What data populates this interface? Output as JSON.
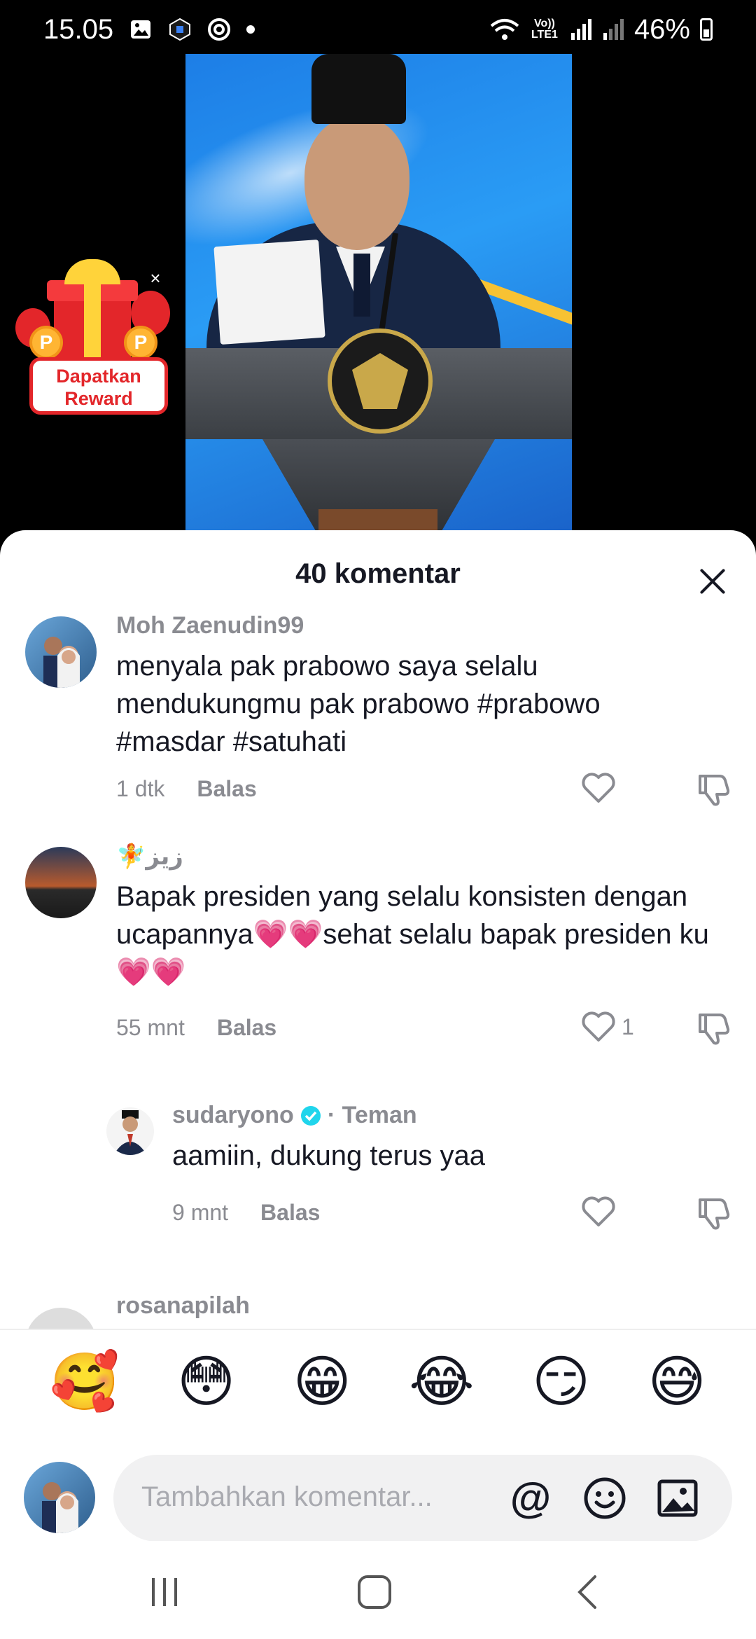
{
  "status_bar": {
    "time": "15.05",
    "battery": "46%",
    "lte": "Vo)) LTE1"
  },
  "reward": {
    "label": "Dapatkan Reward",
    "coin_symbol": "P",
    "close_symbol": "×"
  },
  "sheet": {
    "title": "40 komentar"
  },
  "comments": [
    {
      "username": "Moh Zaenudin99",
      "text": "menyala pak prabowo saya selalu mendukungmu pak prabowo #prabowo #masdar #satuhati",
      "time": "1 dtk",
      "reply_label": "Balas",
      "likes": ""
    },
    {
      "username": "🧚زيز",
      "text": "Bapak presiden yang selalu konsisten dengan ucapannya💗💗sehat selalu bapak presiden ku 💗💗",
      "time": "55 mnt",
      "reply_label": "Balas",
      "likes": "1"
    },
    {
      "username": "sudaryono",
      "badge": "· Teman",
      "text": "aamiin, dukung terus yaa",
      "time": "9 mnt",
      "reply_label": "Balas",
      "likes": ""
    },
    {
      "username": "rosanapilah"
    }
  ],
  "emoji_bar": [
    "🥰",
    "😳",
    "😁",
    "😂",
    "😏",
    "😅"
  ],
  "composer": {
    "placeholder": "Tambahkan komentar...",
    "mention_symbol": "@"
  },
  "colors": {
    "accent_heart": "#ff3b7a",
    "verified": "#20d5ec",
    "reward_red": "#e3262a"
  },
  "icons": {
    "status": [
      "gallery-icon",
      "app-icon",
      "target-icon",
      "wifi-icon",
      "signal-icon",
      "battery-icon"
    ],
    "sheet": [
      "close-icon",
      "heart-outline-icon",
      "dislike-icon",
      "verified-icon"
    ],
    "composer": [
      "at-icon",
      "emoji-icon",
      "image-icon"
    ],
    "nav": [
      "recents-icon",
      "home-icon",
      "back-icon"
    ]
  }
}
